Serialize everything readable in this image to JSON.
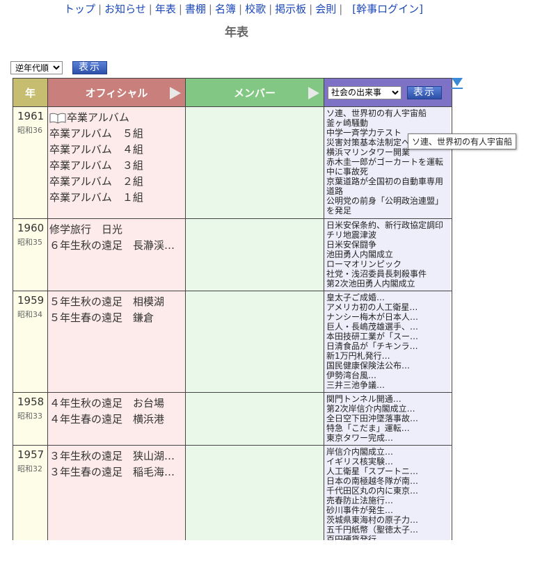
{
  "nav": {
    "top": "トップ",
    "news": "お知らせ",
    "chronology": "年表",
    "bookshelf": "書棚",
    "directory": "名簿",
    "school_song": "校歌",
    "bulletin": "掲示板",
    "rules": "会則",
    "login": "[幹事ログイン]",
    "separator": "|"
  },
  "page_title": "年表",
  "controls": {
    "order_selected": "逆年代順",
    "show_button": "表示",
    "events_selected": "社会の出来事"
  },
  "table_header": {
    "year": "年",
    "official": "オフィシャル",
    "member": "メンバー"
  },
  "rows": [
    {
      "year": "1961",
      "era": "昭和36",
      "official": [
        "卒業アルバム",
        "卒業アルバム　５組",
        "卒業アルバム　４組",
        "卒業アルバム　３組",
        "卒業アルバム　２組",
        "卒業アルバム　１組"
      ],
      "events": [
        "ソ連、世界初の有人宇宙船",
        "釜ヶ崎騒動",
        "中学一斉学力テスト",
        "災害対策基本法制定へ",
        "横浜マリンタワー開業",
        "赤木圭一郎がゴーカートを運転中に事故死",
        "京葉道路が全国初の自動車専用道路",
        "公明党の前身「公明政治連盟」を発足"
      ]
    },
    {
      "year": "1960",
      "era": "昭和35",
      "official": [
        "修学旅行　日光",
        "６年生秋の遠足　長瀞渓…"
      ],
      "events": [
        "日米安保条約、新行政協定調印",
        "チリ地震津波",
        "日米安保闘争",
        "池田勇人内閣成立",
        "ローマオリンピック",
        "社党・浅沼委員長刺殺事件",
        "第2次池田勇人内閣成立"
      ]
    },
    {
      "year": "1959",
      "era": "昭和34",
      "official": [
        "５年生秋の遠足　相模湖",
        "５年生春の遠足　鎌倉"
      ],
      "events": [
        "皇太子ご成婚…",
        "アメリカ初の人工衛星…",
        "ナンシー梅木が日本人…",
        "巨人・長嶋茂雄選手、…",
        "本田技研工業が「スー…",
        "日清食品が「チキンラ…",
        "新1万円札発行…",
        "国民健康保険法公布…",
        "伊勢湾台風…",
        "三井三池争議…"
      ]
    },
    {
      "year": "1958",
      "era": "昭和33",
      "official": [
        "４年生秋の遠足　お台場",
        "４年生春の遠足　横浜港"
      ],
      "events": [
        "関門トンネル開通…",
        "第2次岸信介内閣成立…",
        "全日空下田沖墜落事故…",
        "特急「こだま」運転…",
        "東京タワー完成…"
      ]
    },
    {
      "year": "1957",
      "era": "昭和32",
      "official": [
        "３年生秋の遠足　狭山湖…",
        "３年生春の遠足　稲毛海…"
      ],
      "events": [
        "岸信介内閣成立…",
        "イギリス核実験…",
        "人工衛星「スプートニ…",
        "日本の南極越冬隊が南…",
        "千代田区丸の内に東京…",
        "売春防止法施行…",
        "砂川事件が発生…",
        "茨城県東海村の原子力…",
        "五千円紙幣（聖徳太子…",
        "百円硬貨発行…"
      ]
    }
  ],
  "tooltip": "ソ連、世界初の有人宇宙船"
}
